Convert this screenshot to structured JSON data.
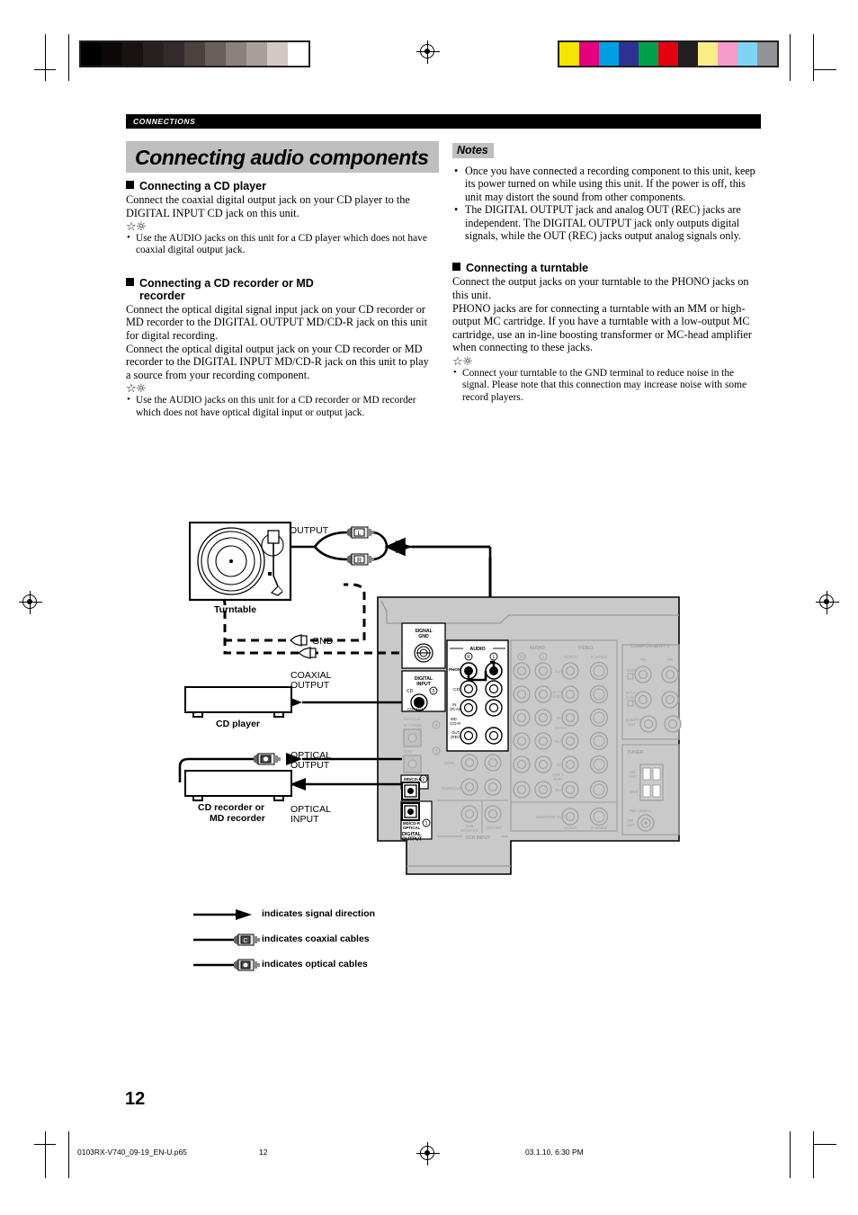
{
  "page": {
    "section_tag": "CONNECTIONS",
    "title": "Connecting audio components",
    "number": "12"
  },
  "left_column": {
    "cd_player": {
      "heading": "Connecting a CD player",
      "body": "Connect the coaxial digital output jack on your CD player to the DIGITAL INPUT CD jack on this unit.",
      "tips": [
        "Use the AUDIO jacks on this unit for a CD player which does not have coaxial digital output jack."
      ]
    },
    "cd_recorder": {
      "heading_line1": "Connecting a CD recorder or MD",
      "heading_line2": "recorder",
      "body1": "Connect the optical digital signal input jack on your CD recorder or MD recorder to the DIGITAL OUTPUT MD/CD-R jack on this unit for digital recording.",
      "body2": "Connect the optical digital output jack on your CD recorder or MD recorder to the DIGITAL INPUT MD/CD-R jack on this unit to play a source from your recording component.",
      "tips": [
        "Use the AUDIO jacks on this unit for a CD recorder or MD recorder which does not have optical digital input or output jack."
      ]
    }
  },
  "right_column": {
    "notes_label": "Notes",
    "notes": [
      "Once you have connected a recording component to this unit, keep its power turned on while using this unit. If the power is off, this unit may distort the sound from other components.",
      "The DIGITAL OUTPUT jack and analog OUT (REC) jacks are independent. The DIGITAL OUTPUT jack only outputs digital signals, while the OUT (REC) jacks output analog signals only."
    ],
    "turntable": {
      "heading": "Connecting a turntable",
      "body1": "Connect the output jacks on your turntable to the PHONO jacks on this unit.",
      "body2": "PHONO jacks are for connecting a turntable with an MM or high-output MC cartridge. If you have a turntable with a low-output MC cartridge, use an in-line boosting transformer or MC-head amplifier when connecting to these jacks.",
      "tips": [
        "Connect your turntable to the GND terminal to reduce noise in the signal. Please note that this connection may increase noise with some record players."
      ]
    }
  },
  "diagram": {
    "devices": [
      {
        "name": "Turntable",
        "label": "Turntable"
      },
      {
        "name": "CD player",
        "label": "CD player"
      },
      {
        "name": "CD recorder or MD recorder",
        "label_line1": "CD recorder or",
        "label_line2": "MD recorder"
      }
    ],
    "cable_labels": {
      "output": "OUTPUT",
      "gnd": "GND",
      "coaxial_output_line1": "COAXIAL",
      "coaxial_output_line2": "OUTPUT",
      "optical_output_line1": "OPTICAL",
      "optical_output_line2": "OUTPUT",
      "optical_input_line1": "OPTICAL",
      "optical_input_line2": "INPUT",
      "plug_l": "L",
      "plug_r": "R",
      "plug_c": "C",
      "plug_o": "O"
    },
    "rear_panel": {
      "signal_gnd_line1": "SIGNAL",
      "signal_gnd_line2": "GND",
      "digital_input_line1": "DIGITAL",
      "digital_input_line2": "INPUT",
      "digital_input_cd": "CD",
      "digital_input_cd_num": "5",
      "coaxial": "COAXIAL",
      "optical_label": "OPTICAL",
      "optical_items": [
        {
          "label_line1": "D-TV/CBL",
          "num": "4"
        },
        {
          "label_line1": "DVD",
          "num": "3"
        },
        {
          "label_line1": "MD/CD-R",
          "num": "2"
        }
      ],
      "digital_output_item": {
        "label_line1": "MD/CD-R",
        "label_line2": "OPTICAL",
        "num": "1"
      },
      "digital_output_line1": "DIGITAL",
      "digital_output_line2": "OUTPUT",
      "audio_group": "AUDIO",
      "audio_r": "R",
      "audio_l": "L",
      "audio_rows": [
        "PHONO",
        "CD",
        "IN (PLAY)",
        "MD /CD-R",
        "OUT (REC)"
      ],
      "audio2_group": "AUDIO",
      "video_group": "VIDEO",
      "video_col1": "VIDEO",
      "video_col2": "S VIDEO",
      "video_rows": [
        "DVD",
        "D-TV /CBL",
        "IN",
        "VCR-1",
        "OUT",
        "IN",
        "VCR 2 /DVR",
        "OUT"
      ],
      "monitor_out": "MONITOR OUT",
      "monitor_video": "VIDEO",
      "monitor_svideo": "S VIDEO",
      "component_v": "COMPORNENT V",
      "component_pb": "PB",
      "component_rows": [
        "DVD",
        "D-TV /CBL",
        "MONITOR OUT"
      ],
      "tuner": "TUNER",
      "am_ant_line1": "AM",
      "am_ant_line2": "ANT",
      "gnd": "GND",
      "unbal": "75Ω UNBAL.",
      "fm_ant_line1": "FM",
      "fm_ant_line2": "ANT",
      "main": "MAIN",
      "surround": "SURROUND",
      "subwoofer_line1": "SUB",
      "subwoofer_line2": "WOOFER",
      "center": "CENTER",
      "sch_input": "6CH INPUT"
    },
    "legend": [
      {
        "key": "arrow",
        "text": "indicates signal direction"
      },
      {
        "key": "coaxial",
        "text": "indicates coaxial cables"
      },
      {
        "key": "optical",
        "text": "indicates optical cables"
      }
    ]
  },
  "footer": {
    "filename": "0103RX-V740_09-19_EN-U.p65",
    "page": "12",
    "timestamp": "03.1.10, 6:30 PM"
  },
  "calibration": {
    "gray_steps": [
      "#000000",
      "#0d0909",
      "#191212",
      "#272020",
      "#332b2b",
      "#4b4240",
      "#6b5f5c",
      "#8c807d",
      "#ab9f9c",
      "#d3c8c6",
      "#ffffff"
    ],
    "color_bars": [
      "#f6e500",
      "#e5007f",
      "#009fe3",
      "#2e3192",
      "#00a04a",
      "#e3000f",
      "#231f20",
      "#faec86",
      "#f59bc9",
      "#7fd4f5",
      "#929497"
    ]
  }
}
